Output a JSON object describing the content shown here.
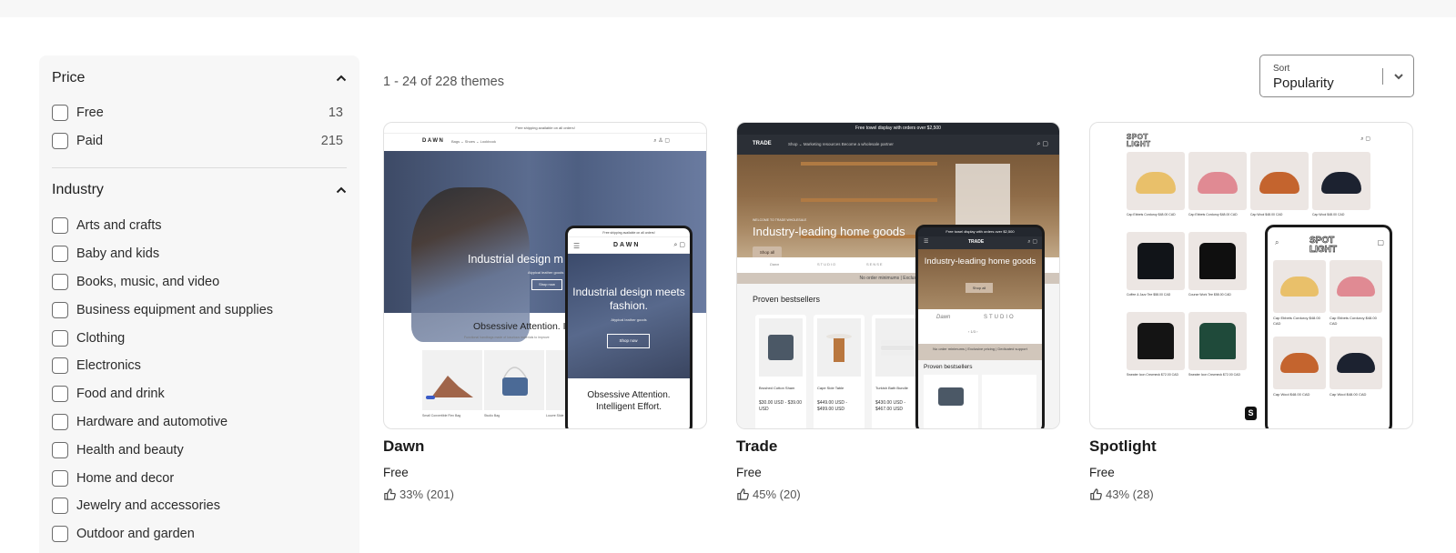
{
  "filters": {
    "price": {
      "title": "Price",
      "options": [
        {
          "label": "Free",
          "count": "13"
        },
        {
          "label": "Paid",
          "count": "215"
        }
      ]
    },
    "industry": {
      "title": "Industry",
      "options": [
        {
          "label": "Arts and crafts"
        },
        {
          "label": "Baby and kids"
        },
        {
          "label": "Books, music, and video"
        },
        {
          "label": "Business equipment and supplies"
        },
        {
          "label": "Clothing"
        },
        {
          "label": "Electronics"
        },
        {
          "label": "Food and drink"
        },
        {
          "label": "Hardware and automotive"
        },
        {
          "label": "Health and beauty"
        },
        {
          "label": "Home and decor"
        },
        {
          "label": "Jewelry and accessories"
        },
        {
          "label": "Outdoor and garden"
        }
      ]
    }
  },
  "results": {
    "count_text": "1 - 24 of 228 themes"
  },
  "sort": {
    "label": "Sort",
    "value": "Popularity"
  },
  "themes": [
    {
      "name": "Dawn",
      "price": "Free",
      "rating": "33% (201)",
      "preview": {
        "announcement": "Free shipping available on all orders!",
        "logo": "DAWN",
        "nav": "Bags ⌄   Shoes ⌄   Lookbook",
        "hero_title": "Industrial design m",
        "hero_sub": "Atypical leather goods",
        "hero_button": "Shop now",
        "section_title": "Obsessive Attention. Int",
        "section_sub": "Functional handbags made of luxurious materials to improve",
        "products": [
          "Small Convertible Flex Bag",
          "Studio Bag",
          "Louvre Slide"
        ],
        "mobile_hero_title": "Industrial design meets fashion.",
        "mobile_hero_sub": "Atypical leather goods",
        "mobile_section": "Obsessive Attention. Intelligent Effort."
      }
    },
    {
      "name": "Trade",
      "price": "Free",
      "rating": "45% (20)",
      "preview": {
        "announcement": "Free towel display with orders over $2,500",
        "logo": "TRADE",
        "nav": "Shop ⌄    Marketing resources    Become a wholesale partner",
        "kicker": "WELCOME TO TRADE WHOLESALE",
        "hero_title": "Industry-leading home goods",
        "hero_button": "Shop all",
        "brands": [
          "Dawn",
          "STUDIO",
          "SENSE"
        ],
        "strip": "No order minimums | Exclusive pricing",
        "section_title": "Proven bestsellers",
        "products": [
          {
            "name": "Brushed Cotton Sham",
            "price": "$30.00 USD - $39.00 USD"
          },
          {
            "name": "Cape Side Table",
            "price": "$449.00 USD - $499.00 USD"
          },
          {
            "name": "Turkish Bath Bundle",
            "price": "$430.00 USD - $467.00 USD"
          }
        ],
        "mobile_hero_title": "Industry-leading home goods",
        "mobile_strip": "No order minimums | Exclusive pricing | Dedicated support",
        "mobile_pager": "‹   1/3   ›"
      }
    },
    {
      "name": "Spotlight",
      "price": "Free",
      "rating": "43% (28)",
      "preview": {
        "logo": "SPOT LIGHT",
        "products": [
          {
            "name": "Cap Ebbets Corduroy",
            "price": "$48.00 CAD",
            "color": "#e9c06a"
          },
          {
            "name": "Cap Ebbets Corduroy",
            "price": "$48.00 CAD",
            "color": "#e08a93"
          },
          {
            "name": "Cap Wool",
            "price": "$48.00 CAD",
            "color": "#c4642e"
          },
          {
            "name": "Cap Wool",
            "price": "$48.00 CAD",
            "color": "#1c2230"
          },
          {
            "name": "Coffee & Jazz Tee",
            "price": "$58.00 CAD",
            "color": "#111418"
          },
          {
            "name": "Course Work Tee",
            "price": "$58.00 CAD",
            "color": "#0f0f0f"
          },
          {
            "name": "Sweater Icon Crewneck",
            "price": "$72.00 CAD",
            "color": "#141414"
          },
          {
            "name": "Sweater Icon Crewneck",
            "price": "$72.00 CAD",
            "color": "#1f4a3a"
          }
        ]
      }
    }
  ],
  "colors": {
    "sidebar_bg": "#f7f7f7",
    "text": "#1f1f1f",
    "muted": "#555555"
  }
}
